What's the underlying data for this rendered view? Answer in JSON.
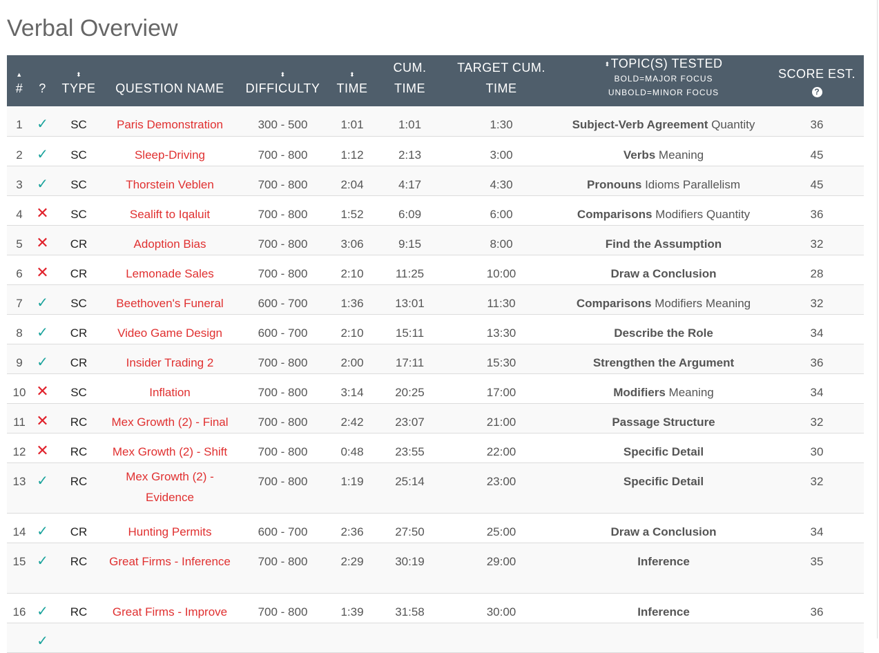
{
  "page": {
    "title": "Verbal Overview"
  },
  "header": {
    "num": "#",
    "status": "?",
    "type": "TYPE",
    "question_name": "QUESTION NAME",
    "difficulty": "DIFFICULTY",
    "time": "TIME",
    "cum_time_1": "CUM.",
    "cum_time_2": "TIME",
    "target_1": "TARGET CUM.",
    "target_2": "TIME",
    "topic": "TOPIC(S) TESTED",
    "topic_sub1": "BOLD=MAJOR FOCUS",
    "topic_sub2": "UNBOLD=MINOR FOCUS",
    "score": "SCORE EST.",
    "help": "?"
  },
  "colors": {
    "header_bg": "#4f5e6b",
    "link": "#e03030",
    "correct": "#1aa39c",
    "incorrect": "#e0202a"
  },
  "rows": [
    {
      "num": "1",
      "result": "correct",
      "type": "SC",
      "name": "Paris Demonstration",
      "difficulty": "300 - 500",
      "time": "1:01",
      "cum": "1:01",
      "target": "1:30",
      "major": "Subject-Verb Agreement",
      "minor": " Quantity",
      "score": "36"
    },
    {
      "num": "2",
      "result": "correct",
      "type": "SC",
      "name": "Sleep-Driving",
      "difficulty": "700 - 800",
      "time": "1:12",
      "cum": "2:13",
      "target": "3:00",
      "major": "Verbs",
      "minor": " Meaning",
      "score": "45"
    },
    {
      "num": "3",
      "result": "correct",
      "type": "SC",
      "name": "Thorstein Veblen",
      "difficulty": "700 - 800",
      "time": "2:04",
      "cum": "4:17",
      "target": "4:30",
      "major": "Pronouns",
      "minor": " Idioms Parallelism",
      "score": "45"
    },
    {
      "num": "4",
      "result": "incorrect",
      "type": "SC",
      "name": "Sealift to Iqaluit",
      "difficulty": "700 - 800",
      "time": "1:52",
      "cum": "6:09",
      "target": "6:00",
      "major": "Comparisons",
      "minor": " Modifiers Quantity",
      "score": "36"
    },
    {
      "num": "5",
      "result": "incorrect",
      "type": "CR",
      "name": "Adoption Bias",
      "difficulty": "700 - 800",
      "time": "3:06",
      "cum": "9:15",
      "target": "8:00",
      "major": "Find the Assumption",
      "minor": "",
      "score": "32"
    },
    {
      "num": "6",
      "result": "incorrect",
      "type": "CR",
      "name": "Lemonade Sales",
      "difficulty": "700 - 800",
      "time": "2:10",
      "cum": "11:25",
      "target": "10:00",
      "major": "Draw a Conclusion",
      "minor": "",
      "score": "28"
    },
    {
      "num": "7",
      "result": "correct",
      "type": "SC",
      "name": "Beethoven's Funeral",
      "difficulty": "600 - 700",
      "time": "1:36",
      "cum": "13:01",
      "target": "11:30",
      "major": "Comparisons",
      "minor": " Modifiers Meaning",
      "score": "32"
    },
    {
      "num": "8",
      "result": "correct",
      "type": "CR",
      "name": "Video Game Design",
      "difficulty": "600 - 700",
      "time": "2:10",
      "cum": "15:11",
      "target": "13:30",
      "major": "Describe the Role",
      "minor": "",
      "score": "34"
    },
    {
      "num": "9",
      "result": "correct",
      "type": "CR",
      "name": "Insider Trading 2",
      "difficulty": "700 - 800",
      "time": "2:00",
      "cum": "17:11",
      "target": "15:30",
      "major": "Strengthen the Argument",
      "minor": "",
      "score": "36"
    },
    {
      "num": "10",
      "result": "incorrect",
      "type": "SC",
      "name": "Inflation",
      "difficulty": "700 - 800",
      "time": "3:14",
      "cum": "20:25",
      "target": "17:00",
      "major": "Modifiers",
      "minor": " Meaning",
      "score": "34"
    },
    {
      "num": "11",
      "result": "incorrect",
      "type": "RC",
      "name": "Mex Growth (2) - Final",
      "difficulty": "700 - 800",
      "time": "2:42",
      "cum": "23:07",
      "target": "21:00",
      "major": "Passage Structure",
      "minor": "",
      "score": "32"
    },
    {
      "num": "12",
      "result": "incorrect",
      "type": "RC",
      "name": "Mex Growth (2) - Shift",
      "difficulty": "700 - 800",
      "time": "0:48",
      "cum": "23:55",
      "target": "22:00",
      "major": "Specific Detail",
      "minor": "",
      "score": "30"
    },
    {
      "num": "13",
      "result": "correct",
      "type": "RC",
      "name": "Mex Growth (2) - Evidence",
      "difficulty": "700 - 800",
      "time": "1:19",
      "cum": "25:14",
      "target": "23:00",
      "major": "Specific Detail",
      "minor": "",
      "score": "32"
    },
    {
      "num": "14",
      "result": "correct",
      "type": "CR",
      "name": "Hunting Permits",
      "difficulty": "600 - 700",
      "time": "2:36",
      "cum": "27:50",
      "target": "25:00",
      "major": "Draw a Conclusion",
      "minor": "",
      "score": "34"
    },
    {
      "num": "15",
      "result": "correct",
      "type": "RC",
      "name": "Great Firms - Inference",
      "difficulty": "700 - 800",
      "time": "2:29",
      "cum": "30:19",
      "target": "29:00",
      "major": "Inference",
      "minor": "",
      "score": "35"
    },
    {
      "num": "16",
      "result": "correct",
      "type": "RC",
      "name": "Great Firms - Improve",
      "difficulty": "700 - 800",
      "time": "1:39",
      "cum": "31:58",
      "target": "30:00",
      "major": "Inference",
      "minor": "",
      "score": "36"
    },
    {
      "num": "",
      "result": "correct",
      "type": "",
      "name": "",
      "difficulty": "",
      "time": "",
      "cum": "",
      "target": "",
      "major": "",
      "minor": "",
      "score": ""
    }
  ]
}
